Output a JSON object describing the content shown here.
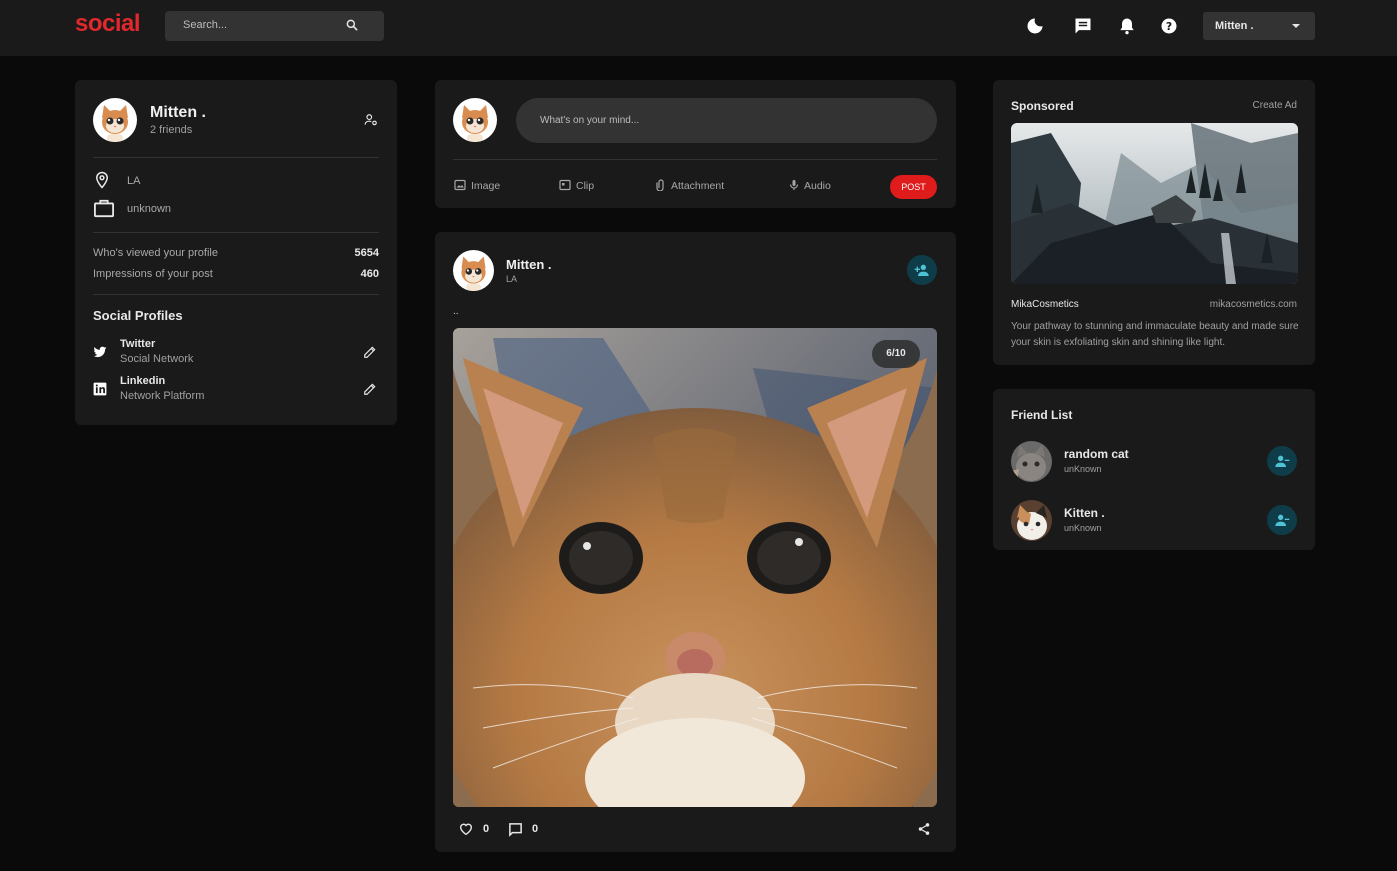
{
  "brand": {
    "logo": "social"
  },
  "navbar": {
    "search_placeholder": "Search...",
    "user_name": "Mitten .",
    "icons": [
      "moon-icon",
      "message-icon",
      "bell-icon",
      "help-icon"
    ]
  },
  "profile": {
    "name": "Mitten .",
    "friends": "2 friends",
    "location": "LA",
    "occupation": "unknown",
    "stats": [
      {
        "label": "Who's viewed your profile",
        "value": "5654"
      },
      {
        "label": "Impressions of your post",
        "value": "460"
      }
    ],
    "social_title": "Social Profiles",
    "social": [
      {
        "name": "Twitter",
        "sub": "Social Network"
      },
      {
        "name": "Linkedin",
        "sub": "Network Platform"
      }
    ]
  },
  "composer": {
    "placeholder": "What's on your mind...",
    "options": [
      "Image",
      "Clip",
      "Attachment",
      "Audio"
    ],
    "post_label": "POST"
  },
  "post": {
    "author": "Mitten .",
    "location": "LA",
    "description": "..",
    "counter": "6/10",
    "likes": "0",
    "comments": "0"
  },
  "sponsored": {
    "title": "Sponsored",
    "create_ad": "Create Ad",
    "brand": "MikaCosmetics",
    "site": "mikacosmetics.com",
    "copy": "Your pathway to stunning and immaculate beauty and made sure your skin is exfoliating skin and shining like light."
  },
  "friend_list": {
    "title": "Friend List",
    "items": [
      {
        "name": "random cat",
        "sub": "unKnown"
      },
      {
        "name": "Kitten .",
        "sub": "unKnown"
      }
    ]
  },
  "colors": {
    "accent": "#e0282d",
    "teal": "#0e3d49",
    "teal_icon": "#4fc3d5",
    "card": "#1a1a1a",
    "bg": "#0a0a0a"
  }
}
